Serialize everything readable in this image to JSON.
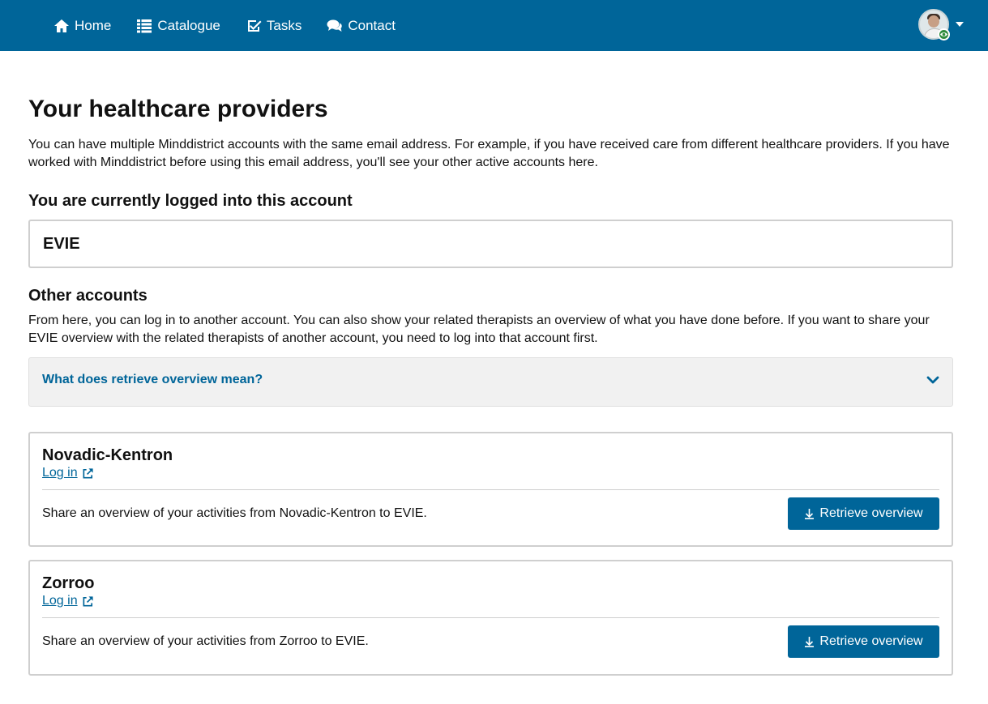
{
  "nav": {
    "items": [
      {
        "label": "Home",
        "icon": "home-icon"
      },
      {
        "label": "Catalogue",
        "icon": "list-icon"
      },
      {
        "label": "Tasks",
        "icon": "check-square-icon"
      },
      {
        "label": "Contact",
        "icon": "comments-icon"
      }
    ],
    "user_avatar": "avatar",
    "user_badge_icon": "eye-icon"
  },
  "page": {
    "title": "Your healthcare providers",
    "intro": "You can have multiple Minddistrict accounts with the same email address. For example, if you have received care from different healthcare providers. If you have worked with Minddistrict before using this email address, you'll see your other active accounts here.",
    "current_heading": "You are currently logged into this account",
    "current_account": "EVIE",
    "other_heading": "Other accounts",
    "other_intro": "From here, you can log in to another account. You can also show your related therapists an overview of what you have done before. If you want to share your EVIE overview with the related therapists of another account, you need to log into that account first.",
    "accordion_label": "What does retrieve overview mean?"
  },
  "accounts": [
    {
      "name": "Novadic-Kentron",
      "login_label": "Log in",
      "share_text": "Share an overview of your activities from Novadic-Kentron to EVIE.",
      "button_label": "Retrieve overview"
    },
    {
      "name": "Zorroo",
      "login_label": "Log in",
      "share_text": "Share an overview of your activities from Zorroo to EVIE.",
      "button_label": "Retrieve overview"
    }
  ],
  "colors": {
    "brand": "#006599",
    "accordion_bg": "#f1f1f1",
    "badge_green": "#2e8b3d"
  }
}
